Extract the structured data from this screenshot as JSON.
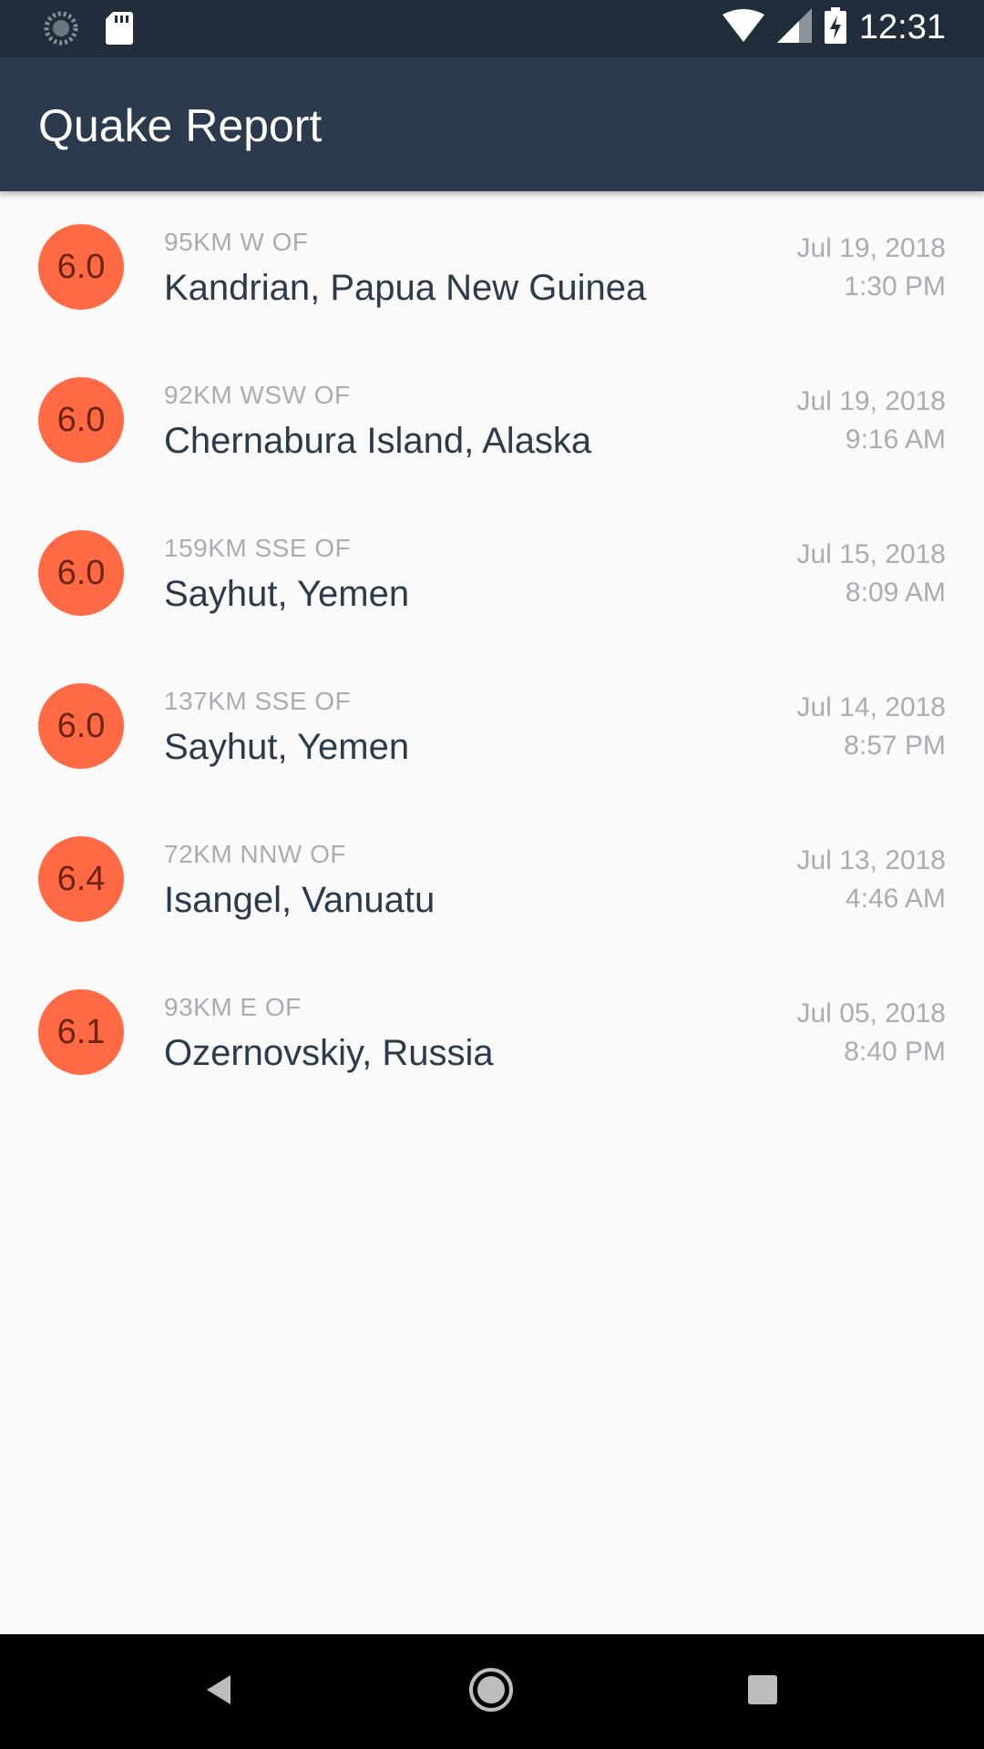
{
  "status_bar": {
    "time": "12:31",
    "left_icons": [
      "loading-spinner-icon",
      "sd-card-icon"
    ],
    "right_icons": [
      "wifi-icon",
      "cell-signal-icon",
      "battery-charging-icon"
    ]
  },
  "app_bar": {
    "title": "Quake Report",
    "color": "#2b3a4d"
  },
  "earthquakes": [
    {
      "magnitude": "6.0",
      "offset": "95KM W OF",
      "place": "Kandrian, Papua New Guinea",
      "date": "Jul 19, 2018",
      "time": "1:30 PM"
    },
    {
      "magnitude": "6.0",
      "offset": "92KM WSW OF",
      "place": "Chernabura Island, Alaska",
      "date": "Jul 19, 2018",
      "time": "9:16 AM"
    },
    {
      "magnitude": "6.0",
      "offset": "159KM SSE OF",
      "place": "Sayhut, Yemen",
      "date": "Jul 15, 2018",
      "time": "8:09 AM"
    },
    {
      "magnitude": "6.0",
      "offset": "137KM SSE OF",
      "place": "Sayhut, Yemen",
      "date": "Jul 14, 2018",
      "time": "8:57 PM"
    },
    {
      "magnitude": "6.4",
      "offset": "72KM NNW OF",
      "place": "Isangel, Vanuatu",
      "date": "Jul 13, 2018",
      "time": "4:46 AM"
    },
    {
      "magnitude": "6.1",
      "offset": "93KM E OF",
      "place": "Ozernovskiy, Russia",
      "date": "Jul 05, 2018",
      "time": "8:40 PM"
    }
  ],
  "colors": {
    "magnitude_circle": "#ff6a45",
    "place_text": "#2d3a49",
    "secondary_text": "#a9adb3"
  },
  "nav_bar": {
    "buttons": [
      "back-icon",
      "home-icon",
      "recents-icon"
    ]
  }
}
